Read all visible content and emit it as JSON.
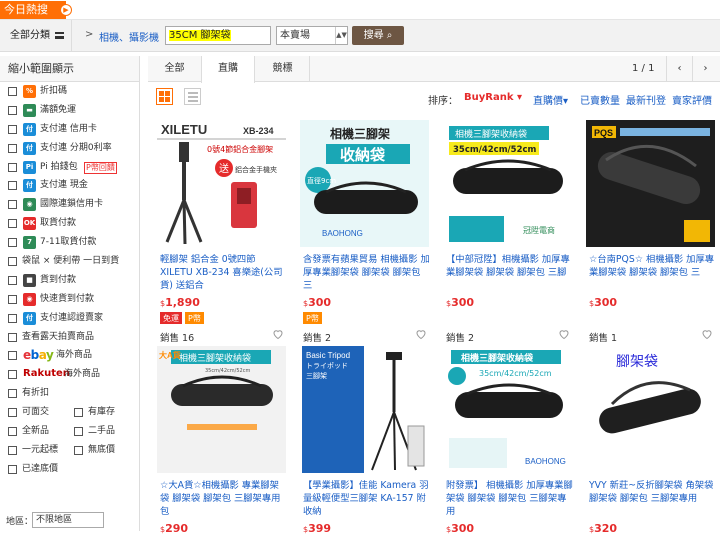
{
  "top": {
    "hot_label": "今日熱搜"
  },
  "searchbar": {
    "all_categories": "全部分類",
    "breadcrumb": "相機、攝影機",
    "query": "35CM 腳架袋",
    "scope": "本賣場",
    "search_button": "搜尋"
  },
  "sidebar": {
    "heading": "縮小範圍顯示",
    "items": [
      {
        "label": "折扣碼",
        "icon": "discount-icon",
        "color": "#ff6f06",
        "glyph": "%"
      },
      {
        "label": "滿額免運",
        "icon": "truck-icon",
        "color": "#2e8b57",
        "glyph": "▬"
      },
      {
        "label": "支付連 信用卡",
        "icon": "payment-icon",
        "color": "#1a8dd8",
        "glyph": "付"
      },
      {
        "label": "支付連 分期0利率",
        "icon": "payment-icon",
        "color": "#1a8dd8",
        "glyph": "付"
      },
      {
        "label": "Pi 拍錢包",
        "icon": "pi-wallet-icon",
        "color": "#1a8dd8",
        "glyph": "Pi",
        "badge": "P幣回饋"
      },
      {
        "label": "支付連 現金",
        "icon": "payment-icon",
        "color": "#1a8dd8",
        "glyph": "付"
      },
      {
        "label": "國際連鎖信用卡",
        "icon": "globe-icon",
        "color": "#2e8b57",
        "glyph": "◉"
      },
      {
        "label": "取貨付款",
        "icon": "ok-mart-icon",
        "color": "#e52b2b",
        "glyph": "OK"
      },
      {
        "label": "7-11取貨付款",
        "icon": "seven-eleven-icon",
        "color": "#2e8b57",
        "glyph": "7"
      },
      {
        "label": "袋鼠 × 便利帶 一日到貨",
        "icon": "",
        "color": "",
        "glyph": ""
      },
      {
        "label": "貨到付款",
        "icon": "cash-on-delivery-icon",
        "color": "#444",
        "glyph": "■"
      },
      {
        "label": "快速貨到付款",
        "icon": "fast-delivery-icon",
        "color": "#e52b2b",
        "glyph": "◉"
      },
      {
        "label": "支付連認證賣家",
        "icon": "verified-seller-icon",
        "color": "#1a8dd8",
        "glyph": "付"
      },
      {
        "label": "查看露天拍賣商品",
        "icon": "",
        "color": "",
        "glyph": ""
      },
      {
        "label": "海外商品",
        "icon": "ebay-icon",
        "color": "",
        "glyph": "ebay"
      },
      {
        "label": "海外商品",
        "icon": "rakuten-icon",
        "color": "",
        "glyph": "Rakuten"
      },
      {
        "label": "有折扣",
        "icon": "",
        "color": "",
        "glyph": ""
      }
    ],
    "pairs": [
      {
        "left": "可面交",
        "right": "有庫存"
      },
      {
        "left": "全新品",
        "right": "二手品"
      },
      {
        "left": "一元起標",
        "right": "無底價"
      }
    ],
    "last": "已達底價",
    "region_label": "地區：",
    "region_value": "不限地區"
  },
  "tabs": {
    "items": [
      "全部",
      "直購",
      "競標"
    ],
    "active": 1,
    "page": "1 / 1",
    "prev": "‹",
    "next": "›"
  },
  "sort": {
    "label": "排序：",
    "items": [
      {
        "label": "BuyRank ▾",
        "active": true
      },
      {
        "label": "直購價▾",
        "active": false
      },
      {
        "label": "已賣數量",
        "active": false
      },
      {
        "label": "最新刊登",
        "active": false
      },
      {
        "label": "賣家評價",
        "active": false
      }
    ]
  },
  "products": [
    {
      "title": "輕腳架 鋁合金 0號四節 XILETU XB-234 喜樂途(公司貨) 送鋁合",
      "price": "1,890",
      "tags": [
        "免運",
        "P幣"
      ],
      "sold": "銷售 16",
      "img_lines": [
        "XILETU",
        "XB-234",
        "0號4節鋁合金腳架",
        "送",
        "鋁合金手機夾"
      ]
    },
    {
      "title": "含發票有蘋果貿易 相機攝影 加厚專業腳架袋 腳架袋 腳架包 三",
      "price": "300",
      "tags": [
        "P幣"
      ],
      "sold": "銷售 2",
      "img_lines": [
        "相機三腳架",
        "收納袋",
        "直徑9cm",
        "BAOHONG"
      ]
    },
    {
      "title": "【中部冠陞】相機攝影 加厚專業腳架袋 腳架袋 腳架包 三腳",
      "price": "300",
      "tags": [],
      "sold": "銷售 2",
      "img_lines": [
        "相機三腳架收納袋",
        "35cm/42cm/52cm",
        "冠陞電商"
      ]
    },
    {
      "title": "☆台南PQS☆ 相機攝影 加厚專業腳架袋 腳架袋 腳架包 三",
      "price": "300",
      "tags": [],
      "sold": "銷售 1",
      "img_lines": [
        "PQS"
      ]
    },
    {
      "title": "☆大A貨☆相機攝影 專業腳架袋 腳架袋 腳架包 三腳架專用包",
      "price": "290",
      "tags": [],
      "sold": "",
      "img_lines": [
        "相機三腳架收納袋",
        "35cm/42cm/52cm",
        "大A貨"
      ]
    },
    {
      "title": "【學業攝影】佳能 Kamera 羽量級輕便型三腳架 KA-157 附收納",
      "price": "399",
      "tags": [],
      "sold": "",
      "img_lines": [
        "Basic Tripod",
        "トライポッド",
        "三腳架"
      ]
    },
    {
      "title": "附發票】 相機攝影 加厚專業腳架袋 腳架袋 腳架包 三腳架專用",
      "price": "300",
      "tags": [],
      "sold": "",
      "img_lines": [
        "相機三腳架收納袋",
        "35cm/42cm/52cm",
        "BAOHONG"
      ]
    },
    {
      "title": "YVY 新莊~反折腳架袋 角架袋 腳架袋 腳架包 三腳架專用",
      "price": "320",
      "tags": [],
      "sold": "",
      "img_lines": [
        "腳架袋"
      ]
    }
  ],
  "currency": "$"
}
